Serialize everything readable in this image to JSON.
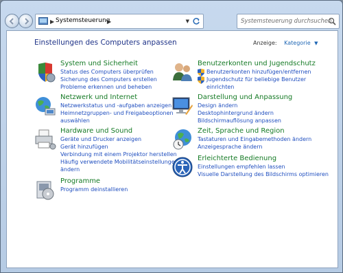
{
  "address": {
    "crumb": "Systemsteuerung"
  },
  "search": {
    "placeholder": "Systemsteuerung durchsuchen"
  },
  "page_title": "Einstellungen des Computers anpassen",
  "view": {
    "label": "Anzeige:",
    "value": "Kategorie"
  },
  "categories_left": [
    {
      "title": "System und Sicherheit",
      "links": [
        "Status des Computers überprüfen",
        "Sicherung des Computers erstellen",
        "Probleme erkennen und beheben"
      ]
    },
    {
      "title": "Netzwerk und Internet",
      "links": [
        "Netzwerkstatus und -aufgaben anzeigen",
        "Heimnetzgruppen- und Freigabeoptionen",
        "auswählen"
      ]
    },
    {
      "title": "Hardware und Sound",
      "links": [
        "Geräte und Drucker anzeigen",
        "Gerät hinzufügen",
        "Verbindung mit einem Projektor herstellen",
        "Häufig verwendete Mobilitätseinstellungen",
        "ändern"
      ]
    },
    {
      "title": "Programme",
      "links": [
        "Programm deinstallieren"
      ]
    }
  ],
  "categories_right": [
    {
      "title": "Benutzerkonten und Jugendschutz",
      "links": [
        "Benutzerkonten hinzufügen/entfernen",
        "Jugendschutz für beliebige Benutzer",
        "einrichten"
      ]
    },
    {
      "title": "Darstellung und Anpassung",
      "links": [
        "Design ändern",
        "Desktophintergrund ändern",
        "Bildschirmauflösung anpassen"
      ]
    },
    {
      "title": "Zeit, Sprache und Region",
      "links": [
        "Tastaturen und Eingabemethoden ändern",
        "Anzeigesprache ändern"
      ]
    },
    {
      "title": "Erleichterte Bedienung",
      "links": [
        "Einstellungen empfehlen lassen",
        "Visuelle Darstellung des Bildschirms optimieren"
      ]
    }
  ]
}
